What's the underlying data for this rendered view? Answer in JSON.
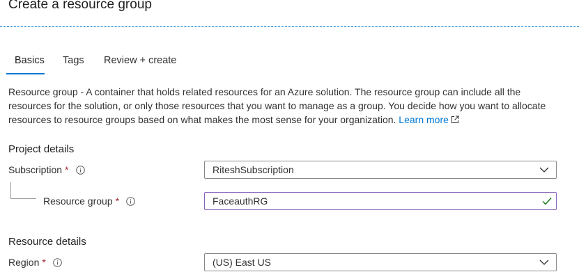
{
  "page": {
    "title": "Create a resource group"
  },
  "tabs": [
    {
      "label": "Basics",
      "active": true
    },
    {
      "label": "Tags",
      "active": false
    },
    {
      "label": "Review + create",
      "active": false
    }
  ],
  "description": {
    "lead": "Resource group",
    "text": " - A container that holds related resources for an Azure solution. The resource group can include all the resources for the solution, or only those resources that you want to manage as a group. You decide how you want to allocate resources to resource groups based on what makes the most sense for your organization.",
    "link": "Learn more"
  },
  "project_details": {
    "heading": "Project details",
    "subscription": {
      "label": "Subscription",
      "required_marker": "*",
      "value": "RiteshSubscription"
    },
    "resource_group": {
      "label": "Resource group",
      "required_marker": "*",
      "value": "FaceauthRG"
    }
  },
  "resource_details": {
    "heading": "Resource details",
    "region": {
      "label": "Region",
      "required_marker": "*",
      "value": "(US) East US"
    }
  },
  "colors": {
    "accent": "#0078d4",
    "required": "#a4262c",
    "valid": "#107c10",
    "focus_border": "#8764b8"
  }
}
